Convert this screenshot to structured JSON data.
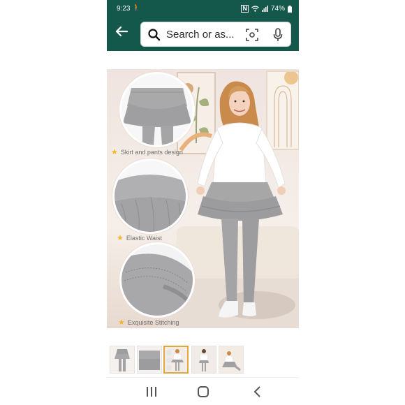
{
  "status_bar": {
    "time": "9:23",
    "battery": "74%"
  },
  "search": {
    "placeholder": "Search or as..."
  },
  "product": {
    "captions": [
      "Skirt and pants design",
      "Elastic Waist",
      "Exquisite Stitching"
    ]
  },
  "thumbnails": {
    "count": 5,
    "selected_index": 2
  },
  "colors": {
    "header_bg": "#13584a",
    "selected_thumb_border": "#e0a73d",
    "caption_star": "#f0b72a"
  }
}
